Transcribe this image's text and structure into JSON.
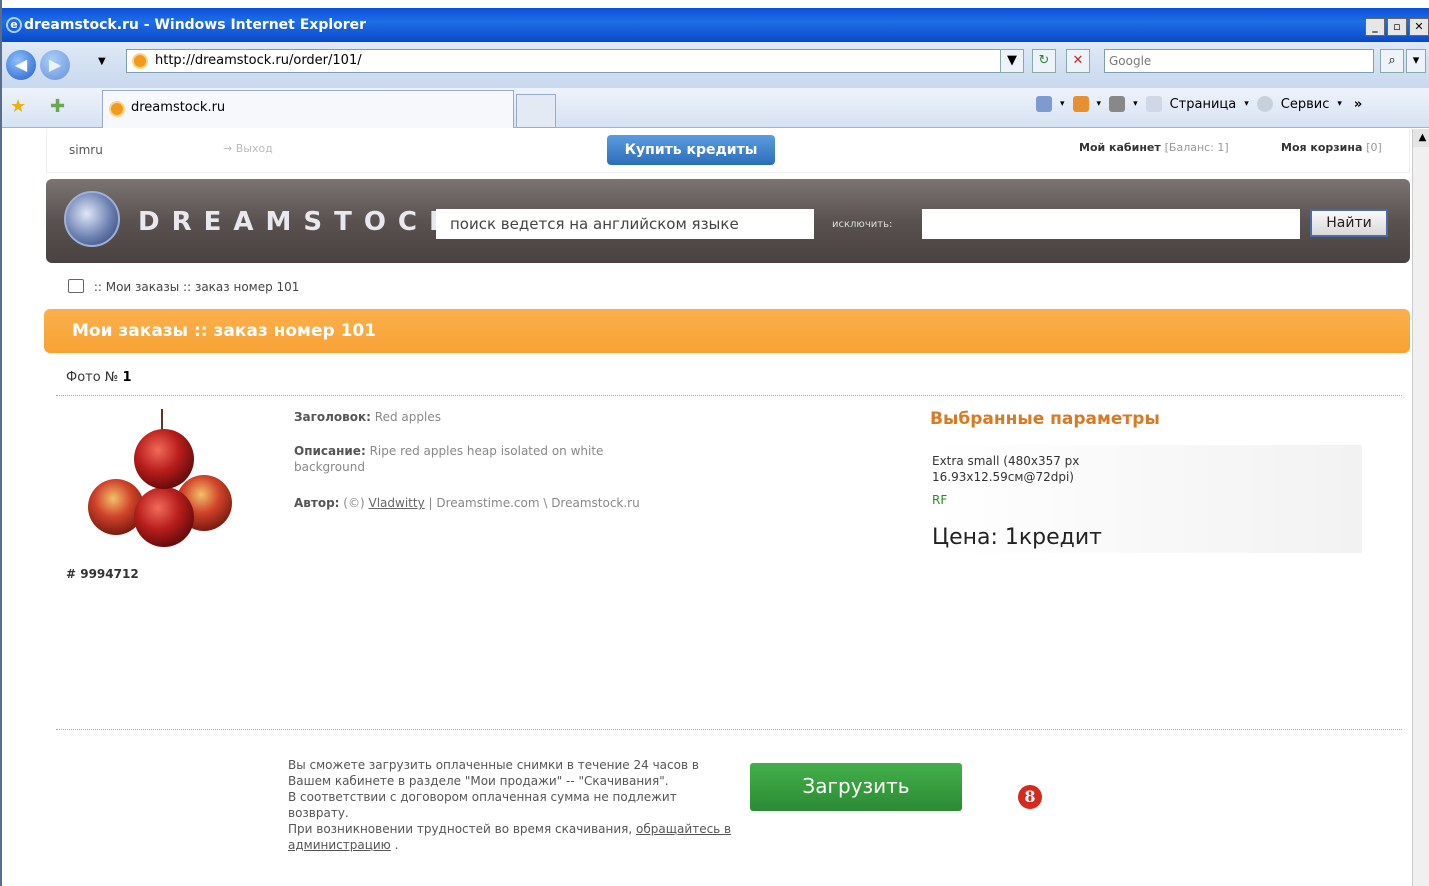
{
  "browser": {
    "title": "dreamstock.ru - Windows Internet Explorer",
    "url": "http://dreamstock.ru/order/101/",
    "search_placeholder": "Google",
    "tab_title": "dreamstock.ru",
    "menu_page": "Страница",
    "menu_service": "Сервис"
  },
  "topbar": {
    "user": "simru",
    "logout": "→ Выход",
    "buy_credits": "Купить кредиты",
    "cabinet": "Мой кабинет",
    "balance": "[Баланс: 1]",
    "cart": "Моя корзина",
    "cart_count": "[0]"
  },
  "header": {
    "logo": "DREAMSTOCK",
    "search_placeholder": "поиск ведется на английском языке",
    "exclude_label": "исключить:",
    "find_button": "Найти"
  },
  "breadcrumb": ":: Мои заказы :: заказ номер 101",
  "section_title": "Мои заказы :: заказ номер 101",
  "photo": {
    "number_label": "Фото №",
    "number": "1",
    "id": "# 9994712",
    "title_label": "Заголовок:",
    "title": "Red apples",
    "desc_label": "Описание:",
    "desc": "Ripe red apples heap isolated on white background",
    "author_label": "Автор:",
    "author_prefix": "(©)",
    "author_name": "Vladwitty",
    "author_suffix": "| Dreamstime.com \\ Dreamstock.ru"
  },
  "params": {
    "heading": "Выбранные параметры",
    "size_line1": "Extra small (480x357 px",
    "size_line2": "16.93x12.59см@72dpi)",
    "license": "RF",
    "price": "Цена: 1кредит"
  },
  "download": {
    "note_line1": "Вы сможете загрузить оплаченные снимки в течение 24 часов в Вашем кабинете в разделе \"Мои продажи\" -- \"Скачивания\".",
    "note_line2": "В соответствии с договором оплаченная сумма не подлежит возврату.",
    "note_line3": "При возникновении трудностей во время скачивания,",
    "contact_link": "обращайтесь в администрацию",
    "note_end": ".",
    "button": "Загрузить"
  },
  "badge": "8"
}
